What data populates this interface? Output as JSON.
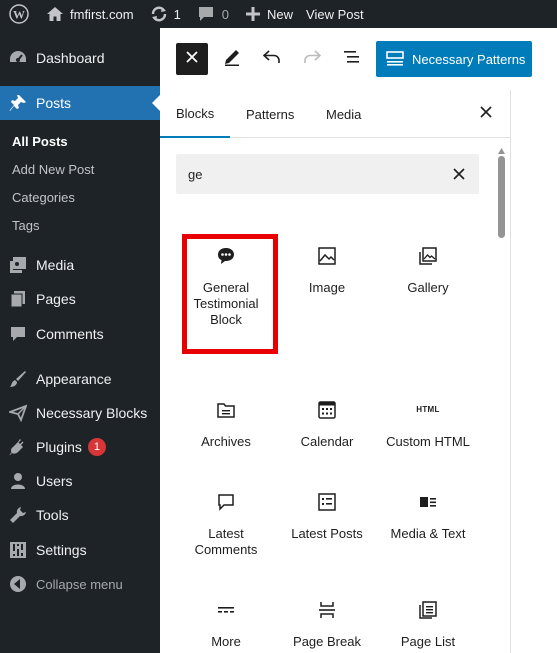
{
  "adminbar": {
    "site_name": "fmfirst.com",
    "updates_count": "1",
    "comments_count": "0",
    "new_label": "New",
    "view_post_label": "View Post"
  },
  "sidebar": {
    "items": [
      {
        "label": "Dashboard",
        "icon": "dashboard-icon"
      },
      {
        "label": "Posts",
        "icon": "pin-icon"
      },
      {
        "label": "Media",
        "icon": "media-icon"
      },
      {
        "label": "Pages",
        "icon": "pages-icon"
      },
      {
        "label": "Comments",
        "icon": "comments-icon"
      },
      {
        "label": "Appearance",
        "icon": "brush-icon"
      },
      {
        "label": "Necessary Blocks",
        "icon": "paper-plane-icon"
      },
      {
        "label": "Plugins",
        "icon": "plug-icon",
        "badge": "1"
      },
      {
        "label": "Users",
        "icon": "users-icon"
      },
      {
        "label": "Tools",
        "icon": "wrench-icon"
      },
      {
        "label": "Settings",
        "icon": "settings-icon"
      }
    ],
    "submenu": [
      "All Posts",
      "Add New Post",
      "Categories",
      "Tags"
    ],
    "collapse_label": "Collapse menu"
  },
  "toolbar": {
    "patterns_button_label": "Necessary Patterns"
  },
  "inserter": {
    "tabs": [
      "Blocks",
      "Patterns",
      "Media"
    ],
    "search_value": "ge",
    "blocks": [
      {
        "label": "General Testimonial Block",
        "icon": "speech-bubble-icon"
      },
      {
        "label": "Image",
        "icon": "image-icon"
      },
      {
        "label": "Gallery",
        "icon": "gallery-icon"
      },
      {
        "label": "Archives",
        "icon": "archive-icon"
      },
      {
        "label": "Calendar",
        "icon": "calendar-icon"
      },
      {
        "label": "Custom HTML",
        "icon": "html-icon"
      },
      {
        "label": "Latest Comments",
        "icon": "comment-icon"
      },
      {
        "label": "Latest Posts",
        "icon": "list-icon"
      },
      {
        "label": "Media & Text",
        "icon": "media-text-icon"
      },
      {
        "label": "More",
        "icon": "more-icon"
      },
      {
        "label": "Page Break",
        "icon": "page-break-icon"
      },
      {
        "label": "Page List",
        "icon": "page-list-icon"
      }
    ],
    "html_icon_text": "HTML"
  },
  "colors": {
    "admin_bg": "#1d2327",
    "accent": "#2271b1",
    "button_blue": "#007cba",
    "highlight_red": "#e80000",
    "badge_red": "#d63638"
  }
}
